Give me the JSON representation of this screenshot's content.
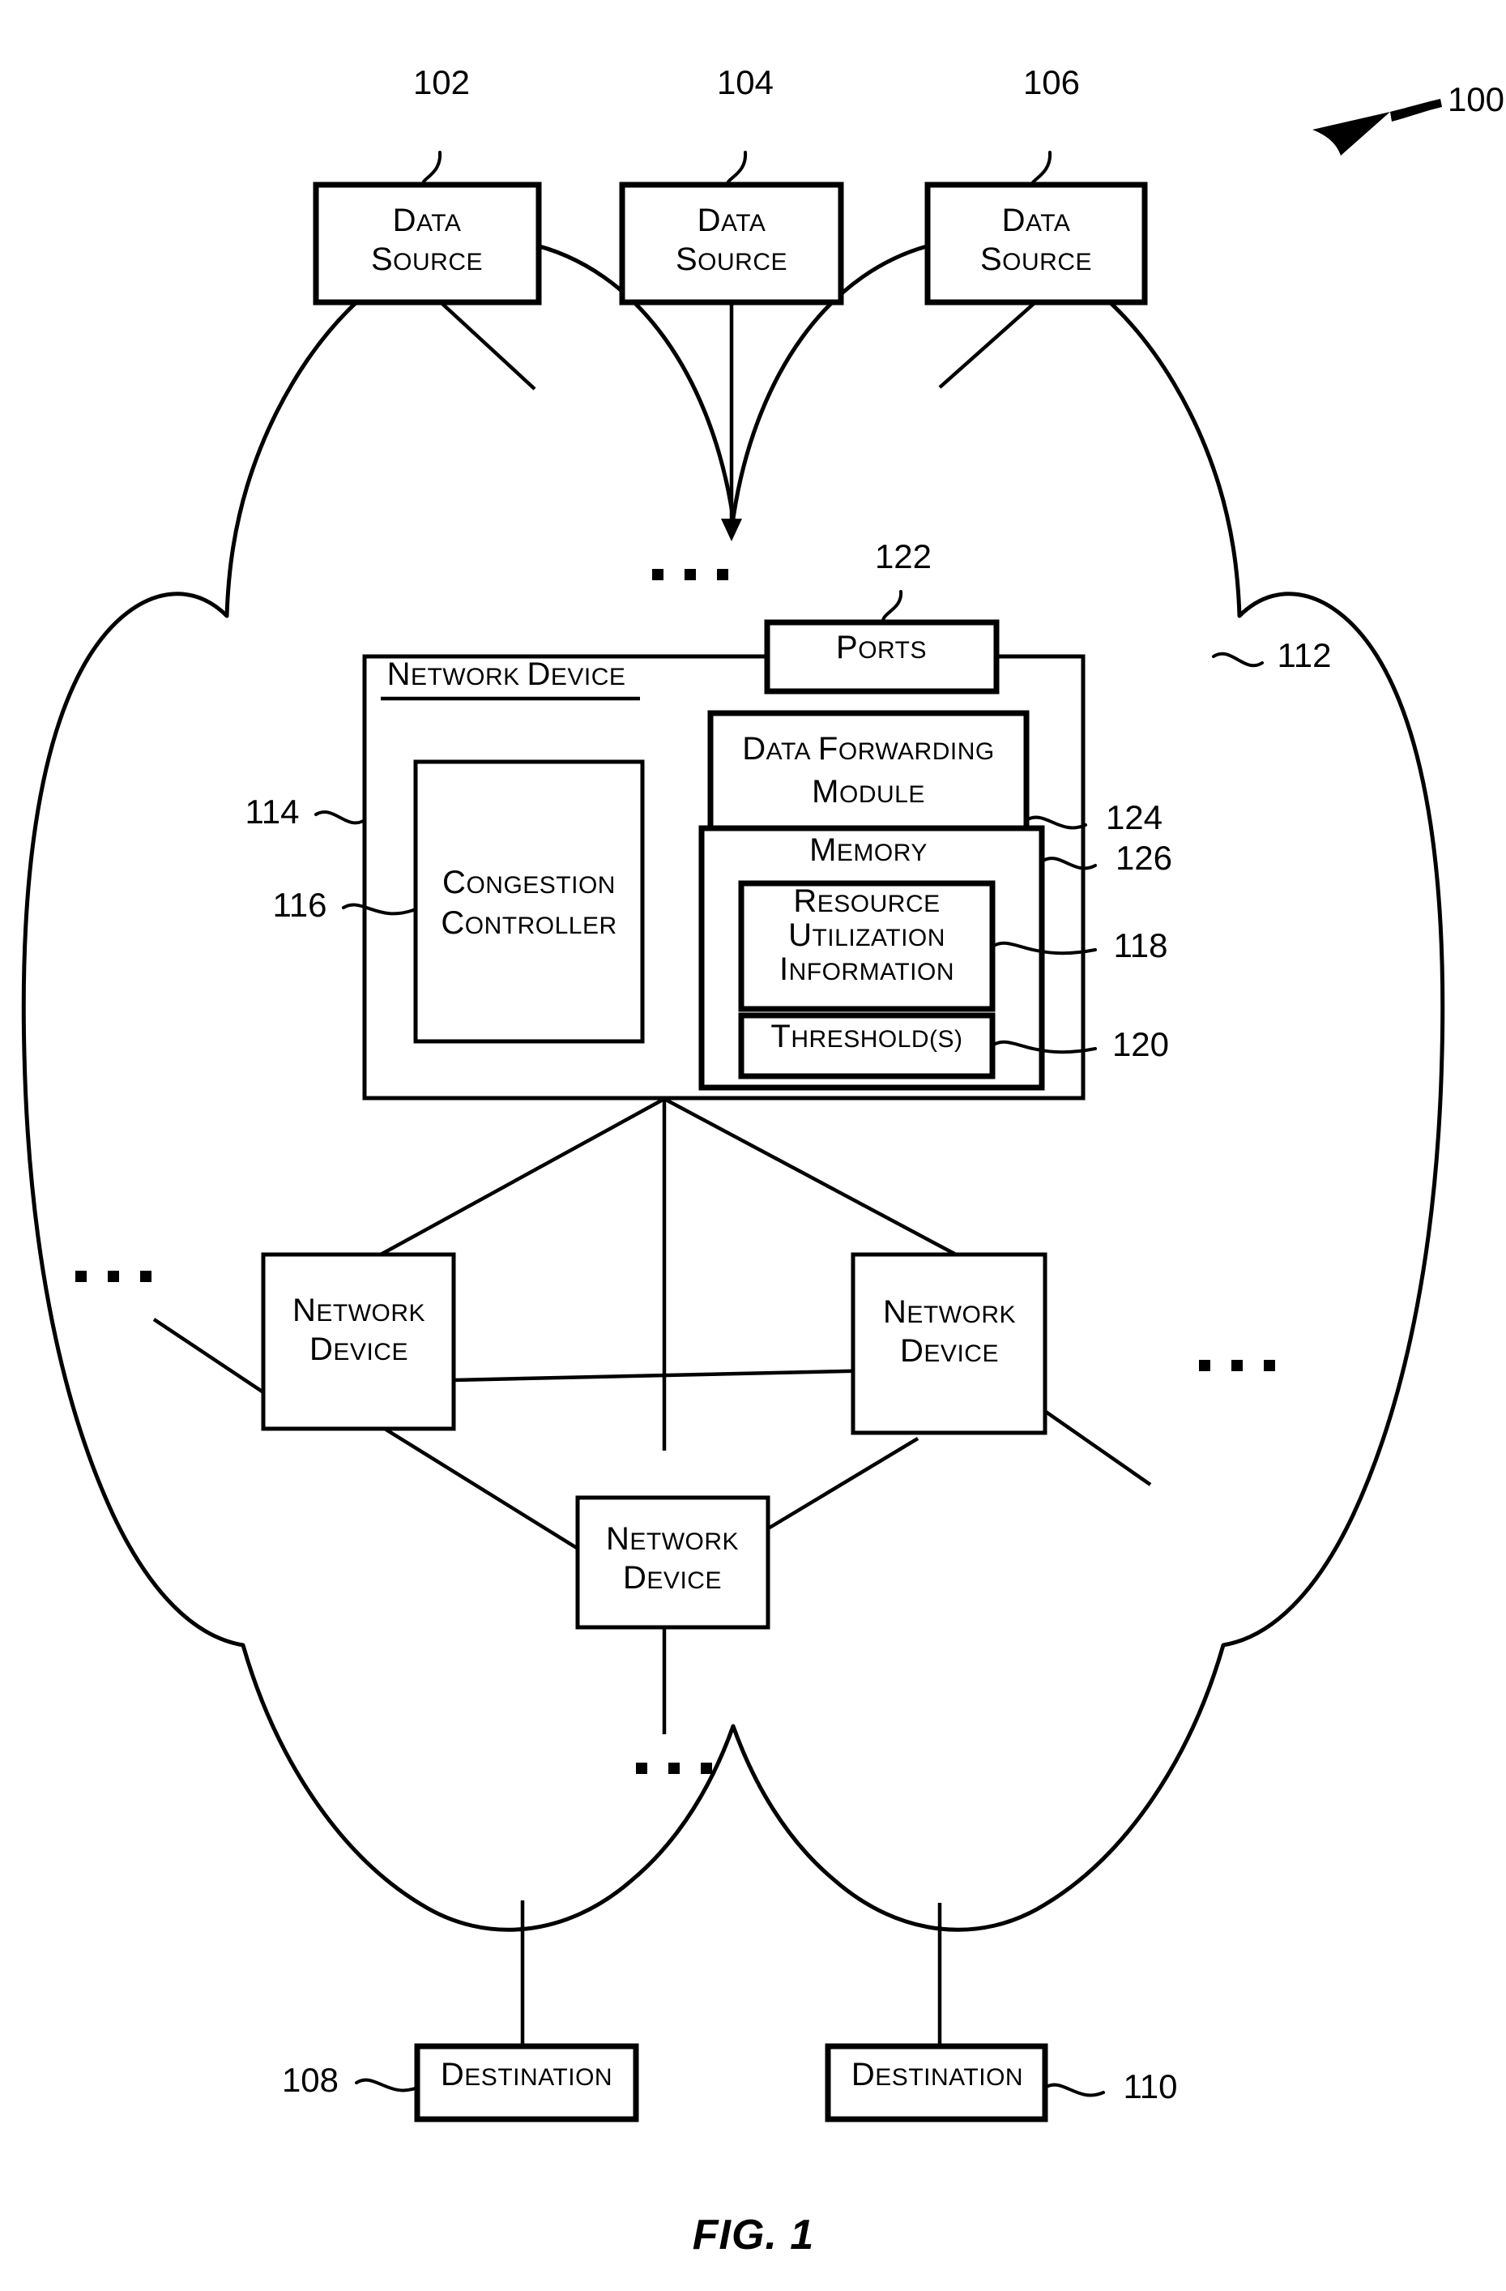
{
  "figure": {
    "caption": "FIG. 1",
    "system_ref": "100"
  },
  "data_sources": [
    {
      "label_line1": "Data",
      "label_line2": "Source",
      "ref": "102"
    },
    {
      "label_line1": "Data",
      "label_line2": "Source",
      "ref": "104"
    },
    {
      "label_line1": "Data",
      "label_line2": "Source",
      "ref": "106"
    }
  ],
  "network": {
    "cloud_ref": "112"
  },
  "network_device": {
    "title": "Network Device",
    "ref": "114",
    "ports": {
      "label": "Ports",
      "ref": "122"
    },
    "congestion_controller": {
      "label_line1": "Congestion",
      "label_line2": "Controller",
      "ref": "116"
    },
    "data_forwarding_module": {
      "label_line1": "Data Forwarding",
      "label_line2": "Module",
      "ref": "124"
    },
    "memory": {
      "label": "Memory",
      "ref": "126",
      "resource_utilization_information": {
        "label_line1": "Resource",
        "label_line2": "Utilization",
        "label_line3": "Information",
        "ref": "118"
      },
      "thresholds": {
        "label": "Threshold(s)",
        "ref": "120"
      }
    }
  },
  "peer_devices": [
    {
      "label_line1": "Network",
      "label_line2": "Device"
    },
    {
      "label_line1": "Network",
      "label_line2": "Device"
    },
    {
      "label_line1": "Network",
      "label_line2": "Device"
    }
  ],
  "destinations": [
    {
      "label": "Destination",
      "ref": "108"
    },
    {
      "label": "Destination",
      "ref": "110"
    }
  ],
  "ellipses": {
    "top": "• • •",
    "left": "• • •",
    "right": "• • •",
    "bottom": "• • •"
  }
}
